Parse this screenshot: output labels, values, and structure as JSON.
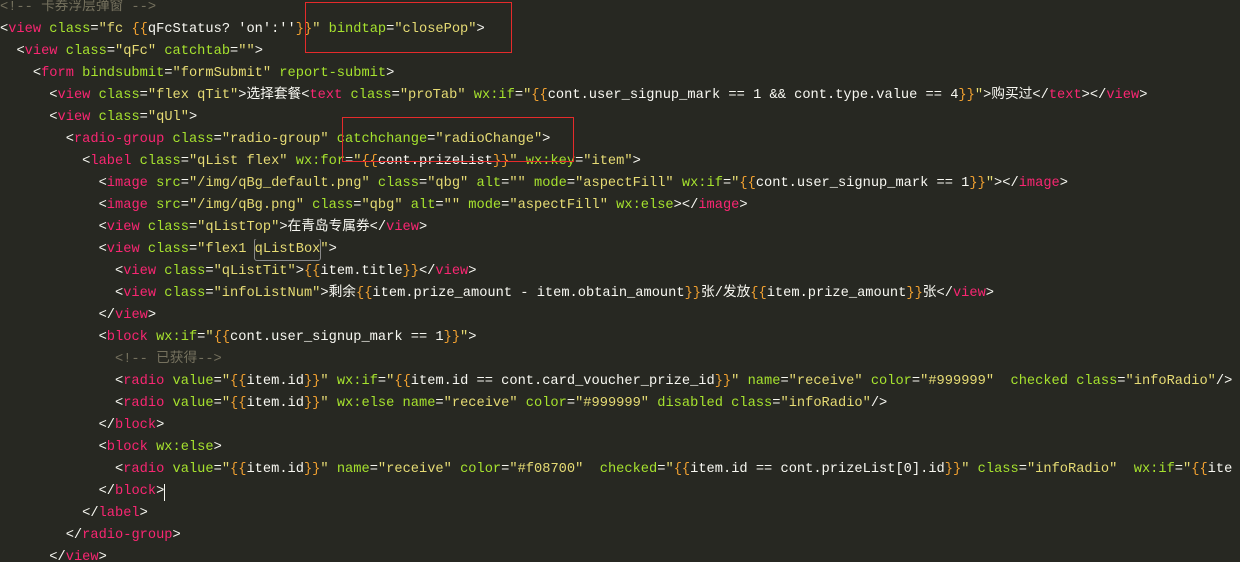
{
  "theme": {
    "background": "#272822",
    "ws": "#f8f8f2",
    "p": "#f8f8f2",
    "tag": "#f92672",
    "attr": "#a6e22e",
    "str": "#e6db74",
    "hl": "#e6db74",
    "brace": "#f0a030",
    "expr": "#f8f8f2",
    "text": "#f8f8f2",
    "comment": "#75715e",
    "highlight_border": "#8a8a8a",
    "annotation": "#e52b2b",
    "caret": "#f8f8f2"
  },
  "editor": {
    "lines": [
      [
        {
          "comment": "<!-- 卡券浮层弹窗 -->"
        }
      ],
      [
        {
          "p": "<"
        },
        {
          "tag": "view"
        },
        {
          "attr": " class"
        },
        {
          "p": "="
        },
        {
          "str": "\"fc "
        },
        {
          "brace": "{{"
        },
        {
          "expr": "qFcStatus? 'on':''"
        },
        {
          "brace": "}}"
        },
        {
          "str": "\""
        },
        {
          "attr": " bindtap"
        },
        {
          "p": "="
        },
        {
          "str": "\"closePop\""
        },
        {
          "p": ">"
        }
      ],
      [
        {
          "ws": "  "
        },
        {
          "p": "<"
        },
        {
          "tag": "view"
        },
        {
          "attr": " class"
        },
        {
          "p": "="
        },
        {
          "str": "\"qFc\""
        },
        {
          "attr": " catchtab"
        },
        {
          "p": "="
        },
        {
          "str": "\"\""
        },
        {
          "p": ">"
        }
      ],
      [
        {
          "ws": "    "
        },
        {
          "p": "<"
        },
        {
          "tag": "form"
        },
        {
          "attr": " bindsubmit"
        },
        {
          "p": "="
        },
        {
          "str": "\"formSubmit\""
        },
        {
          "attr": " report-submit"
        },
        {
          "p": ">"
        }
      ],
      [
        {
          "ws": "      "
        },
        {
          "p": "<"
        },
        {
          "tag": "view"
        },
        {
          "attr": " class"
        },
        {
          "p": "="
        },
        {
          "str": "\"flex qTit\""
        },
        {
          "p": ">"
        },
        {
          "text": "选择套餐"
        },
        {
          "p": "<"
        },
        {
          "tag": "text"
        },
        {
          "attr": " class"
        },
        {
          "p": "="
        },
        {
          "str": "\"proTab\""
        },
        {
          "attr": " wx:if"
        },
        {
          "p": "="
        },
        {
          "str": "\""
        },
        {
          "brace": "{{"
        },
        {
          "expr": "cont.user_signup_mark == 1 && cont.type.value == 4"
        },
        {
          "brace": "}}"
        },
        {
          "str": "\""
        },
        {
          "p": ">"
        },
        {
          "text": "购买过"
        },
        {
          "p": "</"
        },
        {
          "tag": "text"
        },
        {
          "p": "></"
        },
        {
          "tag": "view"
        },
        {
          "p": ">"
        }
      ],
      [
        {
          "ws": "      "
        },
        {
          "p": "<"
        },
        {
          "tag": "view"
        },
        {
          "attr": " class"
        },
        {
          "p": "="
        },
        {
          "str": "\"qUl\""
        },
        {
          "p": ">"
        }
      ],
      [
        {
          "ws": "        "
        },
        {
          "p": "<"
        },
        {
          "tag": "radio-group"
        },
        {
          "attr": " class"
        },
        {
          "p": "="
        },
        {
          "str": "\"radio-group\""
        },
        {
          "attr": " catchchange"
        },
        {
          "p": "="
        },
        {
          "str": "\"radioChange\""
        },
        {
          "p": ">"
        }
      ],
      [
        {
          "ws": "          "
        },
        {
          "p": "<"
        },
        {
          "tag": "label"
        },
        {
          "attr": " class"
        },
        {
          "p": "="
        },
        {
          "str": "\"qList flex\""
        },
        {
          "attr": " wx:for"
        },
        {
          "p": "="
        },
        {
          "str": "\""
        },
        {
          "brace": "{{"
        },
        {
          "expr": "cont.prizeList"
        },
        {
          "brace": "}}"
        },
        {
          "str": "\""
        },
        {
          "attr": " wx:key"
        },
        {
          "p": "="
        },
        {
          "str": "\"item\""
        },
        {
          "p": ">"
        }
      ],
      [
        {
          "ws": "            "
        },
        {
          "p": "<"
        },
        {
          "tag": "image"
        },
        {
          "attr": " src"
        },
        {
          "p": "="
        },
        {
          "str": "\"/img/qBg_default.png\""
        },
        {
          "attr": " class"
        },
        {
          "p": "="
        },
        {
          "str": "\"qbg\""
        },
        {
          "attr": " alt"
        },
        {
          "p": "="
        },
        {
          "str": "\"\""
        },
        {
          "attr": " mode"
        },
        {
          "p": "="
        },
        {
          "str": "\"aspectFill\""
        },
        {
          "attr": " wx:if"
        },
        {
          "p": "="
        },
        {
          "str": "\""
        },
        {
          "brace": "{{"
        },
        {
          "expr": "cont.user_signup_mark == 1"
        },
        {
          "brace": "}}"
        },
        {
          "str": "\""
        },
        {
          "p": "></"
        },
        {
          "tag": "image"
        },
        {
          "p": ">"
        }
      ],
      [
        {
          "ws": "            "
        },
        {
          "p": "<"
        },
        {
          "tag": "image"
        },
        {
          "attr": " src"
        },
        {
          "p": "="
        },
        {
          "str": "\"/img/qBg.png\""
        },
        {
          "attr": " class"
        },
        {
          "p": "="
        },
        {
          "str": "\"qbg\""
        },
        {
          "attr": " alt"
        },
        {
          "p": "="
        },
        {
          "str": "\"\""
        },
        {
          "attr": " mode"
        },
        {
          "p": "="
        },
        {
          "str": "\"aspectFill\""
        },
        {
          "attr": " wx:else"
        },
        {
          "p": "></"
        },
        {
          "tag": "image"
        },
        {
          "p": ">"
        }
      ],
      [
        {
          "ws": "            "
        },
        {
          "p": "<"
        },
        {
          "tag": "view"
        },
        {
          "attr": " class"
        },
        {
          "p": "="
        },
        {
          "str": "\"qListTop\""
        },
        {
          "p": ">"
        },
        {
          "text": "在青岛专属券"
        },
        {
          "p": "</"
        },
        {
          "tag": "view"
        },
        {
          "p": ">"
        }
      ],
      [
        {
          "ws": "            "
        },
        {
          "p": "<"
        },
        {
          "tag": "view"
        },
        {
          "attr": " class"
        },
        {
          "p": "="
        },
        {
          "str": "\"flex1 "
        },
        {
          "hl": "qListBox"
        },
        {
          "str": "\""
        },
        {
          "p": ">"
        }
      ],
      [
        {
          "ws": "              "
        },
        {
          "p": "<"
        },
        {
          "tag": "view"
        },
        {
          "attr": " class"
        },
        {
          "p": "="
        },
        {
          "str": "\"qListTit\""
        },
        {
          "p": ">"
        },
        {
          "brace": "{{"
        },
        {
          "expr": "item.title"
        },
        {
          "brace": "}}"
        },
        {
          "p": "</"
        },
        {
          "tag": "view"
        },
        {
          "p": ">"
        }
      ],
      [
        {
          "ws": "              "
        },
        {
          "p": "<"
        },
        {
          "tag": "view"
        },
        {
          "attr": " class"
        },
        {
          "p": "="
        },
        {
          "str": "\"infoListNum\""
        },
        {
          "p": ">"
        },
        {
          "text": "剩余"
        },
        {
          "brace": "{{"
        },
        {
          "expr": "item.prize_amount - item.obtain_amount"
        },
        {
          "brace": "}}"
        },
        {
          "text": "张/发放"
        },
        {
          "brace": "{{"
        },
        {
          "expr": "item.prize_amount"
        },
        {
          "brace": "}}"
        },
        {
          "text": "张"
        },
        {
          "p": "</"
        },
        {
          "tag": "view"
        },
        {
          "p": ">"
        }
      ],
      [
        {
          "ws": "            "
        },
        {
          "p": "</"
        },
        {
          "tag": "view"
        },
        {
          "p": ">"
        }
      ],
      [
        {
          "ws": "            "
        },
        {
          "p": "<"
        },
        {
          "tag": "block"
        },
        {
          "attr": " wx:if"
        },
        {
          "p": "="
        },
        {
          "str": "\""
        },
        {
          "brace": "{{"
        },
        {
          "expr": "cont.user_signup_mark == 1"
        },
        {
          "brace": "}}"
        },
        {
          "str": "\""
        },
        {
          "p": ">"
        }
      ],
      [
        {
          "ws": "              "
        },
        {
          "comment": "<!-- 已获得-->"
        }
      ],
      [
        {
          "ws": "              "
        },
        {
          "p": "<"
        },
        {
          "tag": "radio"
        },
        {
          "attr": " value"
        },
        {
          "p": "="
        },
        {
          "str": "\""
        },
        {
          "brace": "{{"
        },
        {
          "expr": "item.id"
        },
        {
          "brace": "}}"
        },
        {
          "str": "\""
        },
        {
          "attr": " wx:if"
        },
        {
          "p": "="
        },
        {
          "str": "\""
        },
        {
          "brace": "{{"
        },
        {
          "expr": "item.id == cont.card_voucher_prize_id"
        },
        {
          "brace": "}}"
        },
        {
          "str": "\""
        },
        {
          "attr": " name"
        },
        {
          "p": "="
        },
        {
          "str": "\"receive\""
        },
        {
          "attr": " color"
        },
        {
          "p": "="
        },
        {
          "str": "\"#999999\""
        },
        {
          "attr": "  checked"
        },
        {
          "attr": " class"
        },
        {
          "p": "="
        },
        {
          "str": "\"infoRadio\""
        },
        {
          "p": "/>"
        }
      ],
      [
        {
          "ws": "              "
        },
        {
          "p": "<"
        },
        {
          "tag": "radio"
        },
        {
          "attr": " value"
        },
        {
          "p": "="
        },
        {
          "str": "\""
        },
        {
          "brace": "{{"
        },
        {
          "expr": "item.id"
        },
        {
          "brace": "}}"
        },
        {
          "str": "\""
        },
        {
          "attr": " wx:else"
        },
        {
          "attr": " name"
        },
        {
          "p": "="
        },
        {
          "str": "\"receive\""
        },
        {
          "attr": " color"
        },
        {
          "p": "="
        },
        {
          "str": "\"#999999\""
        },
        {
          "attr": " disabled"
        },
        {
          "attr": " class"
        },
        {
          "p": "="
        },
        {
          "str": "\"infoRadio\""
        },
        {
          "p": "/>"
        }
      ],
      [
        {
          "ws": "            "
        },
        {
          "p": "</"
        },
        {
          "tag": "block"
        },
        {
          "p": ">"
        }
      ],
      [
        {
          "ws": "            "
        },
        {
          "p": "<"
        },
        {
          "tag": "block"
        },
        {
          "attr": " wx:else"
        },
        {
          "p": ">"
        }
      ],
      [
        {
          "ws": "              "
        },
        {
          "p": "<"
        },
        {
          "tag": "radio"
        },
        {
          "attr": " value"
        },
        {
          "p": "="
        },
        {
          "str": "\""
        },
        {
          "brace": "{{"
        },
        {
          "expr": "item.id"
        },
        {
          "brace": "}}"
        },
        {
          "str": "\""
        },
        {
          "attr": " name"
        },
        {
          "p": "="
        },
        {
          "str": "\"receive\""
        },
        {
          "attr": " color"
        },
        {
          "p": "="
        },
        {
          "str": "\"#f08700\""
        },
        {
          "attr": "  checked"
        },
        {
          "p": "="
        },
        {
          "str": "\""
        },
        {
          "brace": "{{"
        },
        {
          "expr": "item.id == cont.prizeList[0].id"
        },
        {
          "brace": "}}"
        },
        {
          "str": "\""
        },
        {
          "attr": " class"
        },
        {
          "p": "="
        },
        {
          "str": "\"infoRadio\""
        },
        {
          "attr": "  wx:if"
        },
        {
          "p": "="
        },
        {
          "str": "\""
        },
        {
          "brace": "{{"
        },
        {
          "expr": "ite"
        }
      ],
      [
        {
          "ws": "            "
        },
        {
          "p": "</"
        },
        {
          "tag": "block"
        },
        {
          "p": ">"
        }
      ],
      [
        {
          "ws": "          "
        },
        {
          "p": "</"
        },
        {
          "tag": "label"
        },
        {
          "p": ">"
        }
      ],
      [
        {
          "ws": "        "
        },
        {
          "p": "</"
        },
        {
          "tag": "radio-group"
        },
        {
          "p": ">"
        }
      ],
      [
        {
          "ws": "      "
        },
        {
          "p": "</"
        },
        {
          "tag": "view"
        },
        {
          "p": ">"
        }
      ]
    ]
  }
}
